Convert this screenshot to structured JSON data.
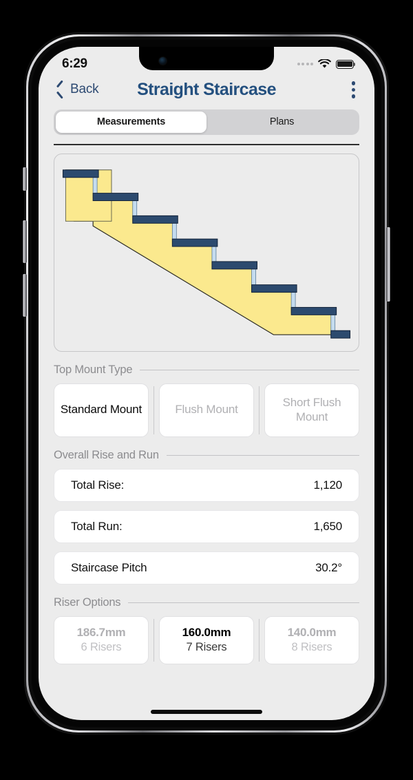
{
  "status_bar": {
    "time": "6:29",
    "signal_icon": "signal-dots-icon",
    "wifi_icon": "wifi-icon",
    "battery_icon": "battery-full-icon"
  },
  "nav": {
    "back_icon": "chevron-left-icon",
    "back_label": "Back",
    "title": "Straight Staircase",
    "menu_icon": "kebab-menu-icon"
  },
  "tabs": [
    {
      "label": "Measurements",
      "selected": true
    },
    {
      "label": "Plans",
      "selected": false
    }
  ],
  "diagram": {
    "name": "staircase-side-elevation",
    "tread_color": "#2c4a6e",
    "stringer_color": "#fbe98e",
    "riser_color": "#c5dcef",
    "outline_color": "#1c1c1c",
    "background": "#ececec",
    "step_count": 7
  },
  "sections": {
    "top_mount": {
      "title": "Top Mount Type",
      "options": [
        {
          "label": "Standard Mount",
          "selected": true
        },
        {
          "label": "Flush Mount",
          "selected": false
        },
        {
          "label": "Short Flush Mount",
          "selected": false
        }
      ]
    },
    "rise_run": {
      "title": "Overall Rise and Run",
      "rows": [
        {
          "key": "Total Rise:",
          "value": "1,120"
        },
        {
          "key": "Total Run:",
          "value": "1,650"
        },
        {
          "key": "Staircase Pitch",
          "value": "30.2°"
        }
      ]
    },
    "riser_options": {
      "title": "Riser Options",
      "options": [
        {
          "size": "186.7mm",
          "count": "6 Risers",
          "selected": false
        },
        {
          "size": "160.0mm",
          "count": "7 Risers",
          "selected": true
        },
        {
          "size": "140.0mm",
          "count": "8 Risers",
          "selected": false
        }
      ]
    }
  }
}
